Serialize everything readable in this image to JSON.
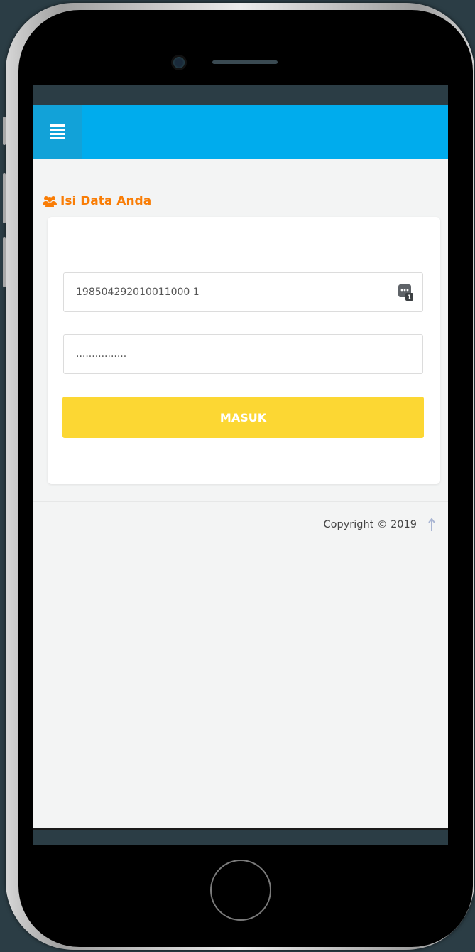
{
  "app": {
    "section_title": "Isi Data Anda",
    "footer_text": "Copyright © 2019"
  },
  "login_form": {
    "username_value": "198504292010011000 1",
    "password_value": "................",
    "submit_label": "MASUK"
  },
  "icons": {
    "menu": "menu-icon",
    "users": "users-icon",
    "id_card": "id-card-icon",
    "scroll_top": "arrow-up-icon"
  },
  "colors": {
    "nav_bar": "#00aced",
    "menu_toggle": "#12a2d8",
    "section_title": "#f97d06",
    "submit_button": "#fcd733",
    "screen_background": "#f3f4f4",
    "status_bar": "#2b3d45"
  }
}
